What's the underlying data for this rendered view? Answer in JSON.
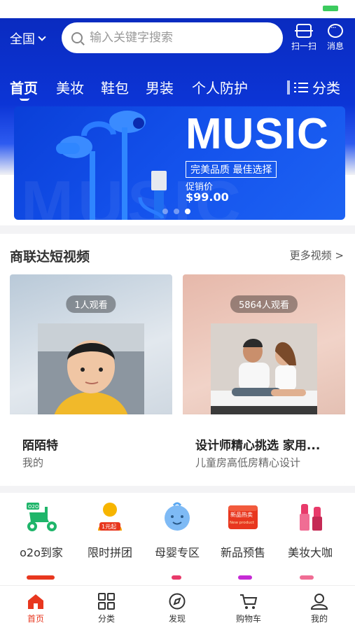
{
  "header": {
    "region": "全国",
    "search_placeholder": "输入关键字搜索",
    "scan_label": "扫一扫",
    "message_label": "消息"
  },
  "tabs": [
    {
      "label": "首页",
      "active": true
    },
    {
      "label": "美妆"
    },
    {
      "label": "鞋包"
    },
    {
      "label": "男装"
    },
    {
      "label": "个人防护"
    }
  ],
  "category_label": "分类",
  "banner": {
    "headline": "MUSIC",
    "tagline": "完美品质 最佳选择",
    "promo_label": "促销价",
    "promo_price": "$99.00",
    "slide_count": 3,
    "active_slide": 3
  },
  "video_section": {
    "title": "商联达短视频",
    "more": "更多视频 >",
    "cards": [
      {
        "views": "1人观看",
        "title": "陌陌特",
        "subtitle": "我的"
      },
      {
        "views": "5864人观看",
        "title": "设计师精心挑选 家用...",
        "subtitle": "儿童房高低房精心设计"
      }
    ]
  },
  "quick_entries": [
    {
      "label": "o2o到家",
      "icon": "scooter-icon",
      "color": "#1fb56a"
    },
    {
      "label": "限时拼团",
      "icon": "group-buy-icon",
      "color": "#f5a300"
    },
    {
      "label": "母婴专区",
      "icon": "baby-icon",
      "color": "#5aa8f2"
    },
    {
      "label": "新品预售",
      "icon": "new-product-icon",
      "color": "#e8371f"
    },
    {
      "label": "美妆大咖",
      "icon": "cosmetics-icon",
      "color": "#e83a6a"
    }
  ],
  "quick_icon_text": {
    "o2o": "O2O",
    "group": "1元起",
    "new_cn": "新品热卖",
    "new_en": "New product"
  },
  "bottom_nav": [
    {
      "label": "首页",
      "icon": "home-icon",
      "active": true
    },
    {
      "label": "分类",
      "icon": "grid-icon"
    },
    {
      "label": "发现",
      "icon": "compass-icon"
    },
    {
      "label": "购物车",
      "icon": "cart-icon"
    },
    {
      "label": "我的",
      "icon": "user-icon"
    }
  ],
  "colors": {
    "primary_blue": "#0c35d6",
    "accent_red": "#e8371f"
  }
}
